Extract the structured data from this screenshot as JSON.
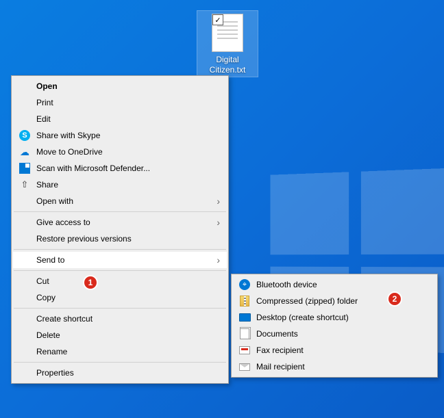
{
  "desktop": {
    "file_name": "Digital Citizen.txt",
    "selected": true,
    "checked": true
  },
  "context_menu": {
    "items": [
      {
        "label": "Open",
        "bold": true
      },
      {
        "label": "Print"
      },
      {
        "label": "Edit"
      },
      {
        "label": "Share with Skype",
        "icon": "skype-icon"
      },
      {
        "label": "Move to OneDrive",
        "icon": "onedrive-icon"
      },
      {
        "label": "Scan with Microsoft Defender...",
        "icon": "defender-icon"
      },
      {
        "label": "Share",
        "icon": "share-icon"
      },
      {
        "label": "Open with",
        "submenu": true
      },
      {
        "sep": true
      },
      {
        "label": "Give access to",
        "submenu": true
      },
      {
        "label": "Restore previous versions"
      },
      {
        "sep": true
      },
      {
        "label": "Send to",
        "submenu": true,
        "highlight": true
      },
      {
        "sep": true
      },
      {
        "label": "Cut"
      },
      {
        "label": "Copy"
      },
      {
        "sep": true
      },
      {
        "label": "Create shortcut"
      },
      {
        "label": "Delete"
      },
      {
        "label": "Rename"
      },
      {
        "sep": true
      },
      {
        "label": "Properties"
      }
    ]
  },
  "send_to_submenu": {
    "items": [
      {
        "label": "Bluetooth device",
        "icon": "bluetooth-icon"
      },
      {
        "label": "Compressed (zipped) folder",
        "icon": "zip-icon"
      },
      {
        "label": "Desktop (create shortcut)",
        "icon": "desktop-icon"
      },
      {
        "label": "Documents",
        "icon": "documents-icon"
      },
      {
        "label": "Fax recipient",
        "icon": "fax-icon"
      },
      {
        "label": "Mail recipient",
        "icon": "mail-icon"
      }
    ]
  },
  "annotations": {
    "badge1": "1",
    "badge2": "2"
  }
}
